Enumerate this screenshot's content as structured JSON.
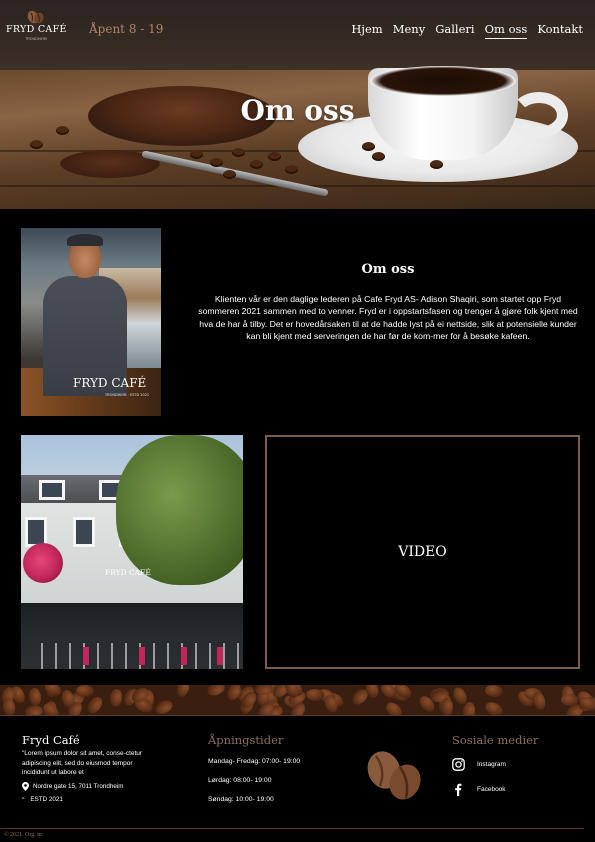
{
  "brand": {
    "name": "FRYD CAFÉ",
    "tagline": "TRONDHEIM"
  },
  "header": {
    "hours": "Åpent 8 - 19",
    "nav": [
      {
        "label": "Hjem",
        "active": false
      },
      {
        "label": "Meny",
        "active": false
      },
      {
        "label": "Galleri",
        "active": false
      },
      {
        "label": "Om oss",
        "active": true
      },
      {
        "label": "Kontakt",
        "active": false
      }
    ]
  },
  "hero": {
    "title": "Om oss"
  },
  "about": {
    "heading": "Om oss",
    "text": "Klienten vår er den daglige lederen på Cafe Fryd AS- Adison Shaqiri, som startet opp Fryd sommeren 2021 sammen med to venner. Fryd er i oppstartsfasen og trenger å gjøre folk kjent med hva de har å tilby. Det er hovedårsaken til at de hadde lyst på ei nettside, slik at potensielle kunder kan bli kjent med serveringen de har før de kom-mer for å besøke kafeen.",
    "photo_brand": "FRYD CAFÉ",
    "photo_brand_sub": "TRONDHEIM · ESTD 2021"
  },
  "store": {
    "sign": "FRYD CAFÉ"
  },
  "video": {
    "label": "VIDEO"
  },
  "footer": {
    "brand": "Fryd Café",
    "lorem": "\"Lorem ipsum dolor sit amet, conse-ctetur adipiscing elit, sed do eiusmod tempor incididunt ut labore et",
    "address": "Nordre gate 15, 7011 Trondheim",
    "estd": "ESTD 2021",
    "hours_title": "Åpningstider",
    "hours": [
      "Mandag- Fredag: 07:00- 19:00",
      "Lørdag: 08:00- 19:00",
      "Søndag: 10:00- 19:00"
    ],
    "social_title": "Sosiale medier",
    "social": [
      {
        "label": "Instagram",
        "icon": "instagram-icon"
      },
      {
        "label": "Facebook",
        "icon": "facebook-icon"
      }
    ],
    "copyright": "© 2021. Org. nr."
  },
  "colors": {
    "accent": "#8c6e5c",
    "hours_badge": "#b08466",
    "video_border": "#7d5f4b",
    "background": "#000000"
  }
}
